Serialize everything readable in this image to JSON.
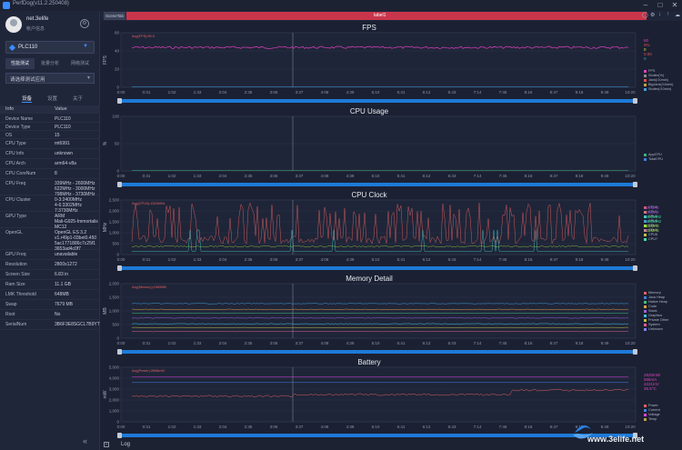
{
  "window": {
    "title": "PerfDog(v11.2.250408)"
  },
  "user": {
    "name": "net.3elife",
    "subtitle": "帐户信息"
  },
  "device": {
    "name": "PLC110"
  },
  "mode_tabs": [
    "性能测试",
    "批量分析",
    "网络测试"
  ],
  "app_select": {
    "placeholder": "请选择测试应用"
  },
  "subtabs": [
    "设备",
    "设置",
    "关于"
  ],
  "info_table": {
    "headers": [
      "Info",
      "Value"
    ],
    "rows": [
      {
        "k": "Device Name",
        "v": "PLC110"
      },
      {
        "k": "Device Type",
        "v": "PLC110"
      },
      {
        "k": "OS",
        "v": "15"
      },
      {
        "k": "CPU Type",
        "v": "mt6991"
      },
      {
        "k": "CPU Info",
        "v": "unknown"
      },
      {
        "k": "CPU Arch",
        "v": "arm64-v8a"
      },
      {
        "k": "CPU CoreNum",
        "v": "8"
      },
      {
        "k": "CPU Freq",
        "v": "339MHz - 2600MHz\n622MHz - 3000MHz\n798MHz - 3730MHz"
      },
      {
        "k": "CPU Cluster",
        "v": "0-3:2400MHz\n4-6:3302MHz\n7:3730MHz"
      },
      {
        "k": "GPU Type",
        "v": "ARM\nMali-G925-Immortalis\nMC12"
      },
      {
        "k": "OpenGL",
        "v": "OpenGL ES 3.2\nv1.r49p1-03bet0.450\n5ac1771886c7c25f1\n3653ad4c0f7"
      },
      {
        "k": "GPU Freq",
        "v": "unavailable"
      },
      {
        "k": "Resolution",
        "v": "2800x1272"
      },
      {
        "k": "Screen Size",
        "v": "6.83 in"
      },
      {
        "k": "Ram Size",
        "v": "11.1 GB"
      },
      {
        "k": "LMK Threshold",
        "v": "648MB"
      },
      {
        "k": "Swap",
        "v": "7679 MB"
      },
      {
        "k": "Root",
        "v": "No"
      },
      {
        "k": "SerialNum",
        "v": "3B6F3E8SGCL7B9YT"
      }
    ]
  },
  "toolbar": {
    "scene_tab": "SceneTab",
    "label": "label1"
  },
  "time_ticks": [
    "0:00",
    "0:31",
    "1:02",
    "1:33",
    "2:04",
    "2:35",
    "3:06",
    "3:37",
    "4:08",
    "4:39",
    "5:10",
    "5:41",
    "6:12",
    "6:43",
    "7:14",
    "7:45",
    "8:16",
    "8:47",
    "9:18",
    "9:49",
    "10:20"
  ],
  "panels": [
    {
      "title": "FPS",
      "ylabel": "FPS",
      "yticks": [
        "0",
        "20",
        "40",
        "60"
      ],
      "legend": [
        {
          "n": "FPS",
          "c": "#e040c0"
        },
        {
          "n": "Stutter(%)",
          "c": "#8b8b8b"
        },
        {
          "n": "Jank(/10min)",
          "c": "#e05050"
        },
        {
          "n": "BigJank(/10min)",
          "c": "#c0a040"
        },
        {
          "n": "Stutter(/10min)",
          "c": "#40a0e0"
        }
      ],
      "side": [
        {
          "t": "60",
          "c": "#e040c0"
        },
        {
          "t": "0%",
          "c": "#e05050"
        },
        {
          "t": "0",
          "c": "#e0e040"
        },
        {
          "t": "0.00",
          "c": "#e05050"
        },
        {
          "t": "0",
          "c": "#40a0e0"
        }
      ],
      "avg_label": "Avg(FPS):59.5"
    },
    {
      "title": "CPU Usage",
      "ylabel": "%",
      "yticks": [
        "0",
        "50",
        "100"
      ],
      "legend": [
        {
          "n": "AppCPU",
          "c": "#40b080"
        },
        {
          "n": "TotalCPU",
          "c": "#4080e0"
        }
      ],
      "side": [],
      "avg_label": ""
    },
    {
      "title": "CPU Clock",
      "ylabel": "MHz",
      "yticks": [
        "0",
        "500",
        "1,000",
        "1,500",
        "2,000",
        "2,500"
      ],
      "legend": [
        {
          "n": "CPU0",
          "c": "#e06060"
        },
        {
          "n": "CPU1",
          "c": "#e09050"
        },
        {
          "n": "CPU2",
          "c": "#40c0c0"
        },
        {
          "n": "CPU3",
          "c": "#4080e0"
        },
        {
          "n": "CPU4",
          "c": "#a0e040"
        },
        {
          "n": "CPU5",
          "c": "#e040e0"
        },
        {
          "n": "CPU6",
          "c": "#c0c040"
        },
        {
          "n": "CPU7",
          "c": "#40e0a0"
        }
      ],
      "side": [
        {
          "t": "339MHz",
          "c": "#a040e0"
        },
        {
          "t": "339MHz",
          "c": "#a040e0"
        },
        {
          "t": "1400MHz",
          "c": "#40e0a0"
        },
        {
          "t": "1400MHz",
          "c": "#40e0a0"
        },
        {
          "t": "622MHz",
          "c": "#a0e040"
        },
        {
          "t": "622MHz",
          "c": "#a0e040"
        }
      ],
      "avg_label": "Avg(CPU0):1283MHz"
    },
    {
      "title": "Memory Detail",
      "ylabel": "MB",
      "yticks": [
        "0",
        "500",
        "1,000",
        "1,500",
        "2,000"
      ],
      "legend": [
        {
          "n": "Memory",
          "c": "#e06060"
        },
        {
          "n": "Java Heap",
          "c": "#4080e0"
        },
        {
          "n": "Native Heap",
          "c": "#40c080"
        },
        {
          "n": "Code",
          "c": "#e0a040"
        },
        {
          "n": "Stack",
          "c": "#a060e0"
        },
        {
          "n": "Graphics",
          "c": "#40c0e0"
        },
        {
          "n": "Private Other",
          "c": "#c0c040"
        },
        {
          "n": "System",
          "c": "#e06090"
        },
        {
          "n": "Unknown",
          "c": "#8080ff"
        }
      ],
      "side": [],
      "avg_label": "Avg(Memory):1965MB"
    },
    {
      "title": "Battery",
      "ylabel": "mW",
      "yticks": [
        "0",
        "1,000",
        "2,000",
        "3,000",
        "4,000",
        "5,000"
      ],
      "legend": [
        {
          "n": "Power",
          "c": "#e06060"
        },
        {
          "n": "Current",
          "c": "#4080e0"
        },
        {
          "n": "Voltage",
          "c": "#e040e0"
        },
        {
          "n": "Temp",
          "c": "#c0a040"
        }
      ],
      "side": [
        {
          "t": "2520mW",
          "c": "#e040c0"
        },
        {
          "t": "596mA",
          "c": "#e040c0"
        },
        {
          "t": "4221mV",
          "c": "#e040c0"
        },
        {
          "t": "36.5°C",
          "c": "#e040c0"
        }
      ],
      "avg_label": "Avg(Power):2658mW"
    }
  ],
  "log_label": "Log",
  "watermark": {
    "text": "www.3elife.net"
  },
  "colors": {
    "accent": "#3b8cff",
    "label_bar": "#c9364b",
    "slider": "#1e7ad8"
  }
}
